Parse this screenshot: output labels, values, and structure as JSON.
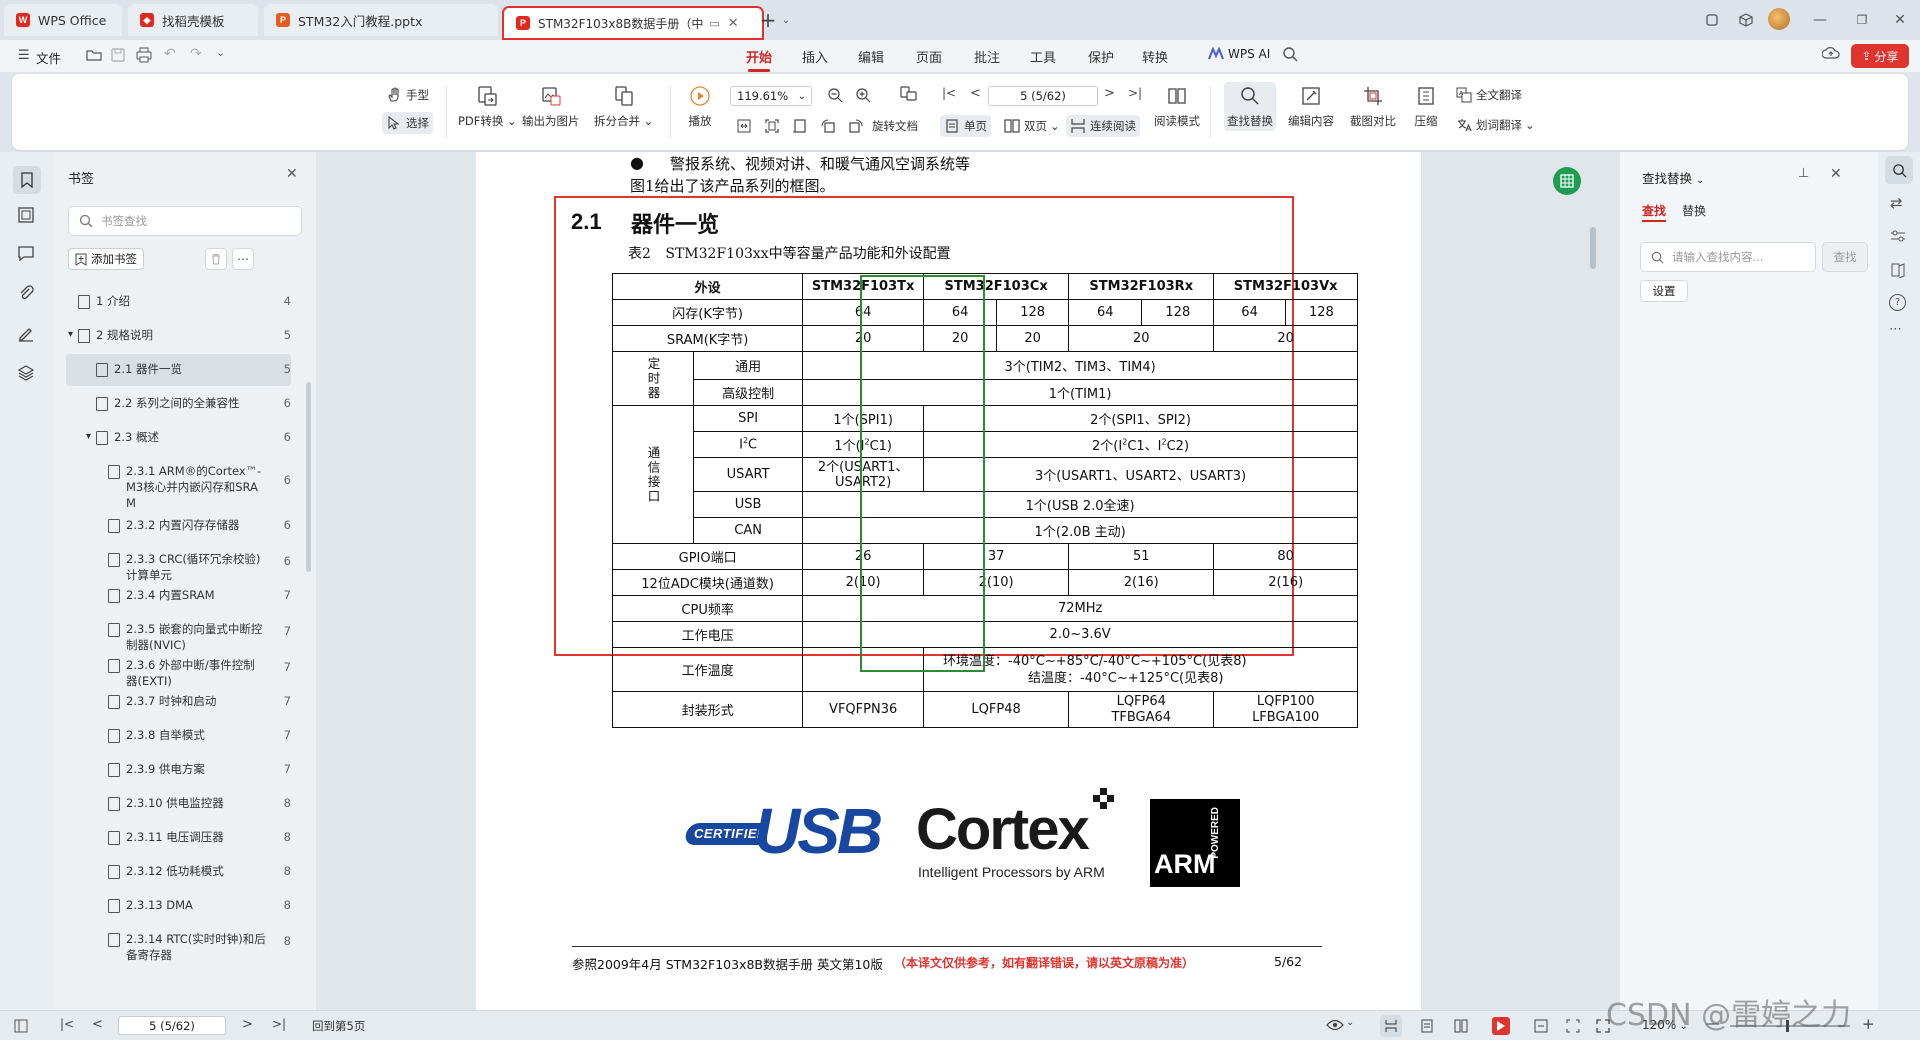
{
  "tabs": [
    {
      "label": "WPS Office",
      "icon": "wps-logo-icon"
    },
    {
      "label": "找稻壳模板",
      "icon": "template-icon"
    },
    {
      "label": "STM32入门教程.pptx",
      "icon": "ppt-file-icon"
    },
    {
      "label": "STM32F103x8B数据手册（中",
      "icon": "pdf-file-icon",
      "active": true
    }
  ],
  "menu": {
    "file": "文件",
    "tabs": [
      "开始",
      "插入",
      "编辑",
      "页面",
      "批注",
      "工具",
      "保护",
      "转换"
    ],
    "active_tab": "开始",
    "wps_ai": "WPS AI",
    "share": "分享"
  },
  "ribbon": {
    "hand": "手型",
    "select": "选择",
    "pdf_convert": "PDF转换",
    "export_image": "输出为图片",
    "split_merge": "拆分合并",
    "play": "播放",
    "zoom": "119.61%",
    "page_input": "5 (5/62)",
    "rotate": "旋转文档",
    "single_page": "单页",
    "double_page": "双页",
    "continuous": "连续阅读",
    "read_mode": "阅读模式",
    "find_replace": "查找替换",
    "edit_content": "编辑内容",
    "screenshot_compare": "截图对比",
    "compress": "压缩",
    "full_translate": "全文翻译",
    "word_translate": "划词翻译"
  },
  "bookmarks": {
    "title": "书签",
    "search_placeholder": "书签查找",
    "add": "添加书签",
    "items": [
      {
        "label": "1 介绍",
        "page": "4",
        "level": 0
      },
      {
        "label": "2 规格说明",
        "page": "5",
        "level": 0,
        "expanded": true
      },
      {
        "label": "2.1 器件一览",
        "page": "5",
        "level": 1,
        "selected": true
      },
      {
        "label": "2.2 系列之间的全兼容性",
        "page": "6",
        "level": 1
      },
      {
        "label": "2.3 概述",
        "page": "6",
        "level": 1,
        "expanded": true
      },
      {
        "label": "2.3.1 ARM®的Cortex™-M3核心并内嵌闪存和SRAM",
        "page": "6",
        "level": 2,
        "lines": [
          "2.3.1 ARM®的Cortex™-",
          "M3核心并内嵌闪存和SRA",
          "M"
        ]
      },
      {
        "label": "2.3.2 内置闪存存储器",
        "page": "6",
        "level": 2
      },
      {
        "label": "2.3.3 CRC(循环冗余校验)计算单元",
        "page": "6",
        "level": 2,
        "lines": [
          "2.3.3 CRC(循环冗余校验)",
          "计算单元"
        ]
      },
      {
        "label": "2.3.4 内置SRAM",
        "page": "7",
        "level": 2
      },
      {
        "label": "2.3.5 嵌套的向量式中断控制器(NVIC)",
        "page": "7",
        "level": 2,
        "lines": [
          "2.3.5 嵌套的向量式中断控",
          "制器(NVIC)"
        ]
      },
      {
        "label": "2.3.6 外部中断/事件控制器(EXTI)",
        "page": "7",
        "level": 2,
        "lines": [
          "2.3.6 外部中断/事件控制",
          "器(EXTI)"
        ]
      },
      {
        "label": "2.3.7 时钟和启动",
        "page": "7",
        "level": 2
      },
      {
        "label": "2.3.8 自举模式",
        "page": "7",
        "level": 2
      },
      {
        "label": "2.3.9 供电方案",
        "page": "7",
        "level": 2
      },
      {
        "label": "2.3.10 供电监控器",
        "page": "8",
        "level": 2
      },
      {
        "label": "2.3.11 电压调压器",
        "page": "8",
        "level": 2
      },
      {
        "label": "2.3.12 低功耗模式",
        "page": "8",
        "level": 2
      },
      {
        "label": "2.3.13 DMA",
        "page": "8",
        "level": 2
      },
      {
        "label": "2.3.14 RTC(实时时钟)和后备寄存器",
        "page": "8",
        "level": 2,
        "lines": [
          "2.3.14 RTC(实时时钟)和后",
          "备寄存器"
        ]
      }
    ]
  },
  "document": {
    "bullet_text": "警报系统、视频对讲、和暖气通风空调系统等",
    "intro_text": "图1给出了该产品系列的框图。",
    "section_number": "2.1",
    "section_title": "器件一览",
    "table_caption_num": "表2",
    "table_caption": "STM32F103xx中等容量产品功能和外设配置",
    "table": {
      "h_peripheral": "外设",
      "h_tx": "STM32F103Tx",
      "h_cx": "STM32F103Cx",
      "h_rx": "STM32F103Rx",
      "h_vx": "STM32F103Vx",
      "flash": "闪存(K字节)",
      "flash_vals": [
        "64",
        "64",
        "128",
        "64",
        "128",
        "64",
        "128"
      ],
      "sram": "SRAM(K字节)",
      "sram_vals": [
        "20",
        "20",
        "20",
        "20",
        "20"
      ],
      "timer_group": "定时器",
      "timer_general": "通用",
      "timer_general_val": "3个(TIM2、TIM3、TIM4)",
      "timer_adv": "高级控制",
      "timer_adv_val": "1个(TIM1)",
      "comm_group": "通信接口",
      "spi": "SPI",
      "spi_tx": "1个(SPI1)",
      "spi_rest": "2个(SPI1、SPI2)",
      "i2c_pre": "I",
      "i2c_sup": "2",
      "i2c_post": "C",
      "i2c_tx_a": "1个(I",
      "i2c_tx_b": "C1)",
      "i2c_rest_a": "2个(I",
      "i2c_rest_b": "C1、I",
      "i2c_rest_c": "C2)",
      "usart": "USART",
      "usart_tx": "2个(USART1、USART2)",
      "usart_tx_l1": "2个(USART1、",
      "usart_tx_l2": "USART2)",
      "usart_rest": "3个(USART1、USART2、USART3)",
      "usb": "USB",
      "usb_val": "1个(USB 2.0全速)",
      "can": "CAN",
      "can_val": "1个(2.0B 主动)",
      "gpio": "GPIO端口",
      "gpio_vals": [
        "26",
        "37",
        "51",
        "80"
      ],
      "adc": "12位ADC模块(通道数)",
      "adc_vals": [
        "2(10)",
        "2(10)",
        "2(16)",
        "2(16)"
      ],
      "cpu": "CPU频率",
      "cpu_val": "72MHz",
      "voltage": "工作电压",
      "voltage_val": "2.0~3.6V",
      "temp": "工作温度",
      "temp_l1": "环境温度：-40°C~+85°C/-40°C~+105°C(见表8)",
      "temp_l2": "结温度：-40°C~+125°C(见表8)",
      "package": "封装形式",
      "pkg_tx": "VFQFPN36",
      "pkg_cx": "LQFP48",
      "pkg_rx_l1": "LQFP64",
      "pkg_rx_l2": "TFBGA64",
      "pkg_vx_l1": "LQFP100",
      "pkg_vx_l2": "LFBGA100"
    },
    "logos": {
      "usb_certified": "CERTIFIED",
      "usb": "USB",
      "cortex": "Cortex",
      "cortex_tagline": "Intelligent Processors by ARM",
      "arm": "ARM",
      "arm_powered": "POWERED"
    },
    "footer_ref": "参照2009年4月 STM32F103x8B数据手册 英文第10版",
    "footer_note": "（本译文仅供参考，如有翻译错误，请以英文原稿为准）",
    "footer_page": "5/62"
  },
  "find_panel": {
    "title": "查找替换",
    "tab_find": "查找",
    "tab_replace": "替换",
    "placeholder": "请输入查找内容...",
    "find_button": "查找",
    "settings": "设置"
  },
  "status": {
    "page_input": "5 (5/62)",
    "back_to": "回到第5页",
    "zoom": "120%"
  },
  "watermark": "CSDN @雷婷之力",
  "colors": {
    "accent": "#d4261f",
    "highlight_red": "#e0342f",
    "highlight_green": "#2e8b34"
  }
}
